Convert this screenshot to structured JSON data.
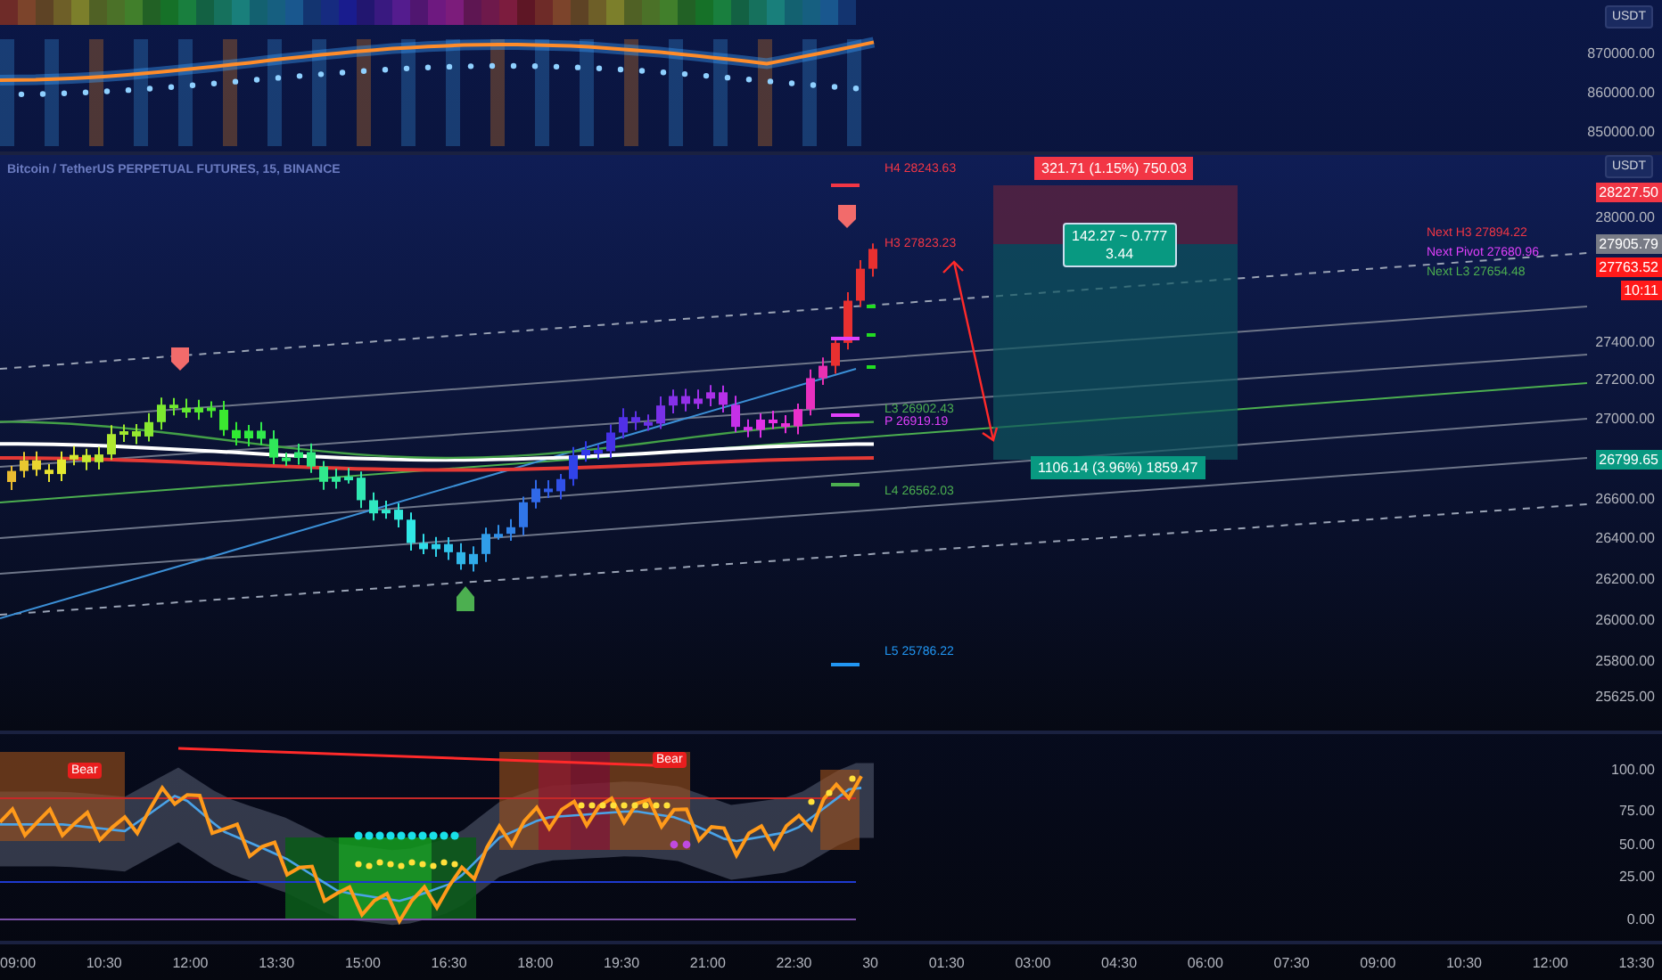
{
  "top_pane": {
    "currency_badge": "USDT",
    "price_ticks": [
      "870000.00",
      "860000.00",
      "850000.00"
    ]
  },
  "main_pane": {
    "symbol_title": "Bitcoin / TetherUS PERPETUAL FUTURES, 15, BINANCE",
    "currency_badge": "USDT",
    "price_ticks": [
      "28000.00",
      "27400.00",
      "27200.00",
      "27000.00",
      "26600.00",
      "26400.00",
      "26200.00",
      "26000.00",
      "25800.00",
      "25625.00"
    ],
    "price_tags": [
      {
        "text": "28227.50",
        "color": "#f23645"
      },
      {
        "text": "27905.79",
        "color": "#787b86"
      },
      {
        "text": "27763.52",
        "color": "#ff1a1a"
      },
      {
        "text": "10:11",
        "color": "#ff1a1a"
      },
      {
        "text": "26799.65",
        "color": "#089981"
      }
    ],
    "pivot_labels": [
      {
        "text": "H4 28243.63",
        "color": "#f23645"
      },
      {
        "text": "H3 27823.23",
        "color": "#f23645"
      },
      {
        "text": "L3 26902.43",
        "color": "#4caf50"
      },
      {
        "text": "P 26919.19",
        "color": "#e040fb"
      },
      {
        "text": "L4 26562.03",
        "color": "#4caf50"
      },
      {
        "text": "L5 25786.22",
        "color": "#2196f3"
      }
    ],
    "next_level_labels": [
      {
        "text": "Next H3 27894.22",
        "color": "#f23645"
      },
      {
        "text": "Next Pivot 27680.96",
        "color": "#e040fb"
      },
      {
        "text": "Next L3 27654.48",
        "color": "#4caf50"
      }
    ],
    "position": {
      "target_label": "321.71 (1.15%) 750.03",
      "ratio_label": "142.27 ~ 0.777",
      "ratio_sub": "3.44",
      "stop_label": "1106.14 (3.96%) 1859.47"
    }
  },
  "oscillator_pane": {
    "signal_badges": [
      "Bear",
      "Bear"
    ],
    "level_ticks": [
      "100.00",
      "75.00",
      "50.00",
      "25.00",
      "0.00"
    ]
  },
  "time_axis": [
    "09:00",
    "10:30",
    "12:00",
    "13:30",
    "15:00",
    "16:30",
    "18:00",
    "19:30",
    "21:00",
    "22:30",
    "30",
    "01:30",
    "03:00",
    "04:30",
    "06:00",
    "07:30",
    "09:00",
    "10:30",
    "12:00",
    "13:30"
  ]
}
